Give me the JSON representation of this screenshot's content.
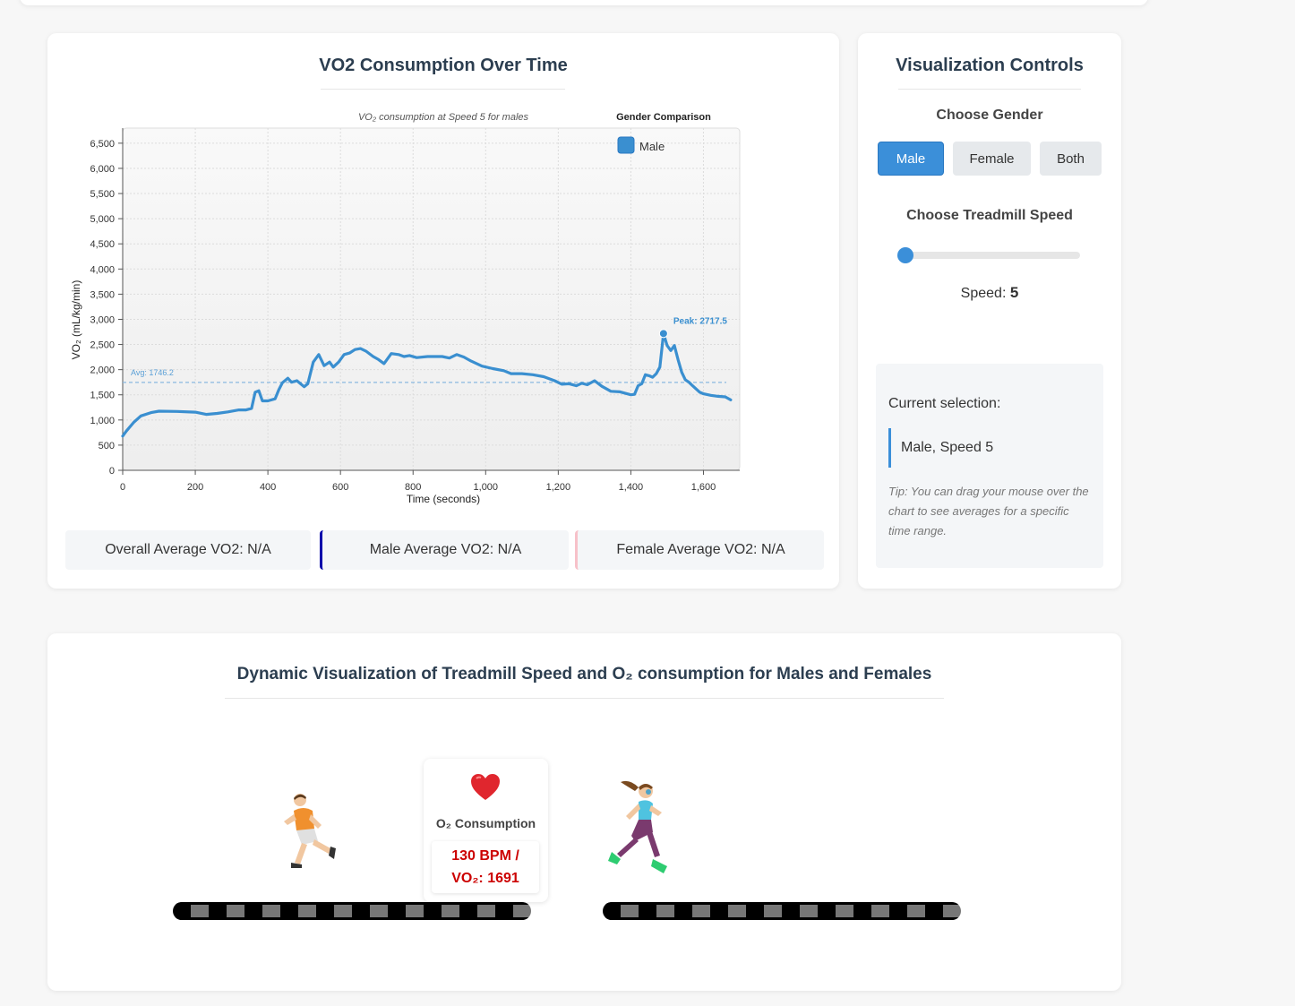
{
  "chart_card": {
    "title": "VO2 Consumption Over Time",
    "stats": {
      "overall": "Overall Average VO2: N/A",
      "male": "Male Average VO2: N/A",
      "female": "Female Average VO2: N/A"
    }
  },
  "chart_data": {
    "type": "line",
    "subtitle": "VO₂ consumption at Speed 5 for males",
    "xlabel": "Time (seconds)",
    "ylabel": "VO₂ (mL/kg/min)",
    "xlim": [
      0,
      1700
    ],
    "ylim": [
      0,
      6800
    ],
    "x_ticks": [
      0,
      200,
      400,
      600,
      800,
      1000,
      1200,
      1400,
      1600
    ],
    "x_tick_labels": [
      "0",
      "200",
      "400",
      "600",
      "800",
      "1,000",
      "1,200",
      "1,400",
      "1,600"
    ],
    "y_ticks": [
      0,
      500,
      1000,
      1500,
      2000,
      2500,
      3000,
      3500,
      4000,
      4500,
      5000,
      5500,
      6000,
      6500
    ],
    "y_tick_labels": [
      "0",
      "500",
      "1,000",
      "1,500",
      "2,000",
      "2,500",
      "3,000",
      "3,500",
      "4,000",
      "4,500",
      "5,000",
      "5,500",
      "6,000",
      "6,500"
    ],
    "grid": true,
    "legend": {
      "title": "Gender Comparison",
      "position": "top-right"
    },
    "series": [
      {
        "name": "Male",
        "color": "#3a8fd0",
        "x": [
          0,
          10,
          30,
          50,
          80,
          100,
          150,
          200,
          230,
          260,
          290,
          320,
          340,
          355,
          365,
          375,
          385,
          400,
          420,
          430,
          440,
          455,
          465,
          480,
          500,
          510,
          525,
          540,
          555,
          570,
          580,
          595,
          610,
          625,
          640,
          655,
          670,
          690,
          705,
          720,
          740,
          760,
          775,
          790,
          810,
          840,
          880,
          900,
          920,
          940,
          960,
          990,
          1020,
          1050,
          1070,
          1100,
          1130,
          1160,
          1190,
          1210,
          1230,
          1250,
          1265,
          1280,
          1300,
          1320,
          1345,
          1370,
          1385,
          1400,
          1410,
          1420,
          1430,
          1440,
          1450,
          1460,
          1470,
          1480,
          1490,
          1500,
          1510,
          1520,
          1530,
          1540,
          1550,
          1560,
          1570,
          1590,
          1600,
          1620,
          1640,
          1660,
          1675
        ],
        "values": [
          680,
          780,
          950,
          1080,
          1150,
          1175,
          1170,
          1155,
          1110,
          1130,
          1160,
          1200,
          1200,
          1230,
          1550,
          1580,
          1380,
          1380,
          1420,
          1600,
          1740,
          1830,
          1750,
          1780,
          1660,
          1720,
          2150,
          2300,
          2080,
          2150,
          2050,
          2150,
          2300,
          2330,
          2400,
          2420,
          2370,
          2260,
          2200,
          2120,
          2320,
          2300,
          2260,
          2280,
          2240,
          2260,
          2260,
          2230,
          2300,
          2250,
          2170,
          2070,
          2020,
          1980,
          1920,
          1920,
          1900,
          1860,
          1780,
          1710,
          1720,
          1680,
          1730,
          1700,
          1780,
          1670,
          1570,
          1560,
          1530,
          1500,
          1510,
          1680,
          1720,
          1900,
          1880,
          1850,
          1920,
          2050,
          2717.5,
          2480,
          2380,
          2480,
          2200,
          1950,
          1800,
          1750,
          1680,
          1550,
          1520,
          1490,
          1470,
          1460,
          1400
        ]
      }
    ],
    "average": {
      "value": 1746.2,
      "label": "Avg: 1746.2"
    },
    "peak": {
      "x": 1490,
      "value": 2717.5,
      "label": "Peak: 2717.5"
    }
  },
  "controls": {
    "title": "Visualization Controls",
    "gender_label": "Choose Gender",
    "gender_options": [
      "Male",
      "Female",
      "Both"
    ],
    "gender_selected": "Male",
    "speed_label": "Choose Treadmill Speed",
    "speed_prefix": "Speed:",
    "speed_value": "5",
    "slider_fraction": 0.0,
    "selection_label": "Current selection:",
    "selection_value": "Male, Speed 5",
    "tip": "Tip: You can drag your mouse over the chart to see averages for a specific time range."
  },
  "animation": {
    "title": "Dynamic Visualization of Treadmill Speed and O₂ consumption for Males and Females",
    "o2_label": "O₂ Consumption",
    "o2_line1": "130 BPM /",
    "o2_line2": "VO₂: 1691",
    "male_runner_icon": "male-runner-icon",
    "female_runner_icon": "female-runner-icon",
    "heart_icon": "heart-icon"
  }
}
